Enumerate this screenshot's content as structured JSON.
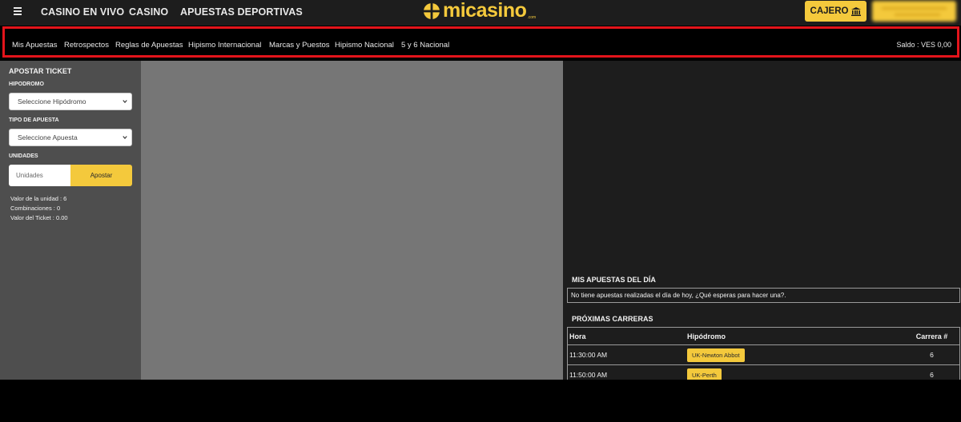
{
  "topnav": {
    "links": [
      "CASINO EN VIVO",
      "CASINO",
      "APUESTAS DEPORTIVAS"
    ],
    "logo_text": "micasino",
    "logo_sub": ".com",
    "cashier_label": "CAJERO",
    "cashier_icon": "bank-icon",
    "menu_icon": "hamburger-icon"
  },
  "subnav": {
    "links": [
      "Mis Apuestas",
      "Retrospectos",
      "Reglas de Apuestas",
      "Hipismo Internacional",
      "Marcas y Puestos",
      "Hipismo Nacional",
      "5 y 6 Nacional"
    ],
    "balance": "Saldo : VES 0,00"
  },
  "ticket": {
    "title": "APOSTAR TICKET",
    "hipodromo_label": "HIPODROMO",
    "hipodromo_selected": "Seleccione Hipódromo",
    "tipo_label": "TIPO DE APUESTA",
    "tipo_selected": "Seleccione Apuesta",
    "unidades_label": "UNIDADES",
    "unidades_placeholder": "Unidades",
    "apostar_label": "Apostar",
    "info": [
      "Valor de la unidad : 6",
      "Combinaciones : 0",
      "Valor del Ticket : 0.00"
    ]
  },
  "my_bets": {
    "title": "MIS APUESTAS DEL DÍA",
    "empty_message": "No tiene apuestas realizadas el día de hoy, ¿Qué esperas para hacer una?."
  },
  "races": {
    "title": "PRÓXIMAS CARRERAS",
    "headers": [
      "Hora",
      "Hipódromo",
      "Carrera #"
    ],
    "rows": [
      {
        "hora": "11:30:00 AM",
        "hipodromo": "UK-Newton Abbot",
        "carrera": "6"
      },
      {
        "hora": "11:50:00 AM",
        "hipodromo": "UK-Perth",
        "carrera": "6"
      }
    ]
  },
  "colors": {
    "accent": "#f4c93c",
    "highlight_border": "#e3141b",
    "panel_left": "#4e4e4e",
    "panel_middle": "#767676",
    "panel_right": "#1d1d1d"
  }
}
